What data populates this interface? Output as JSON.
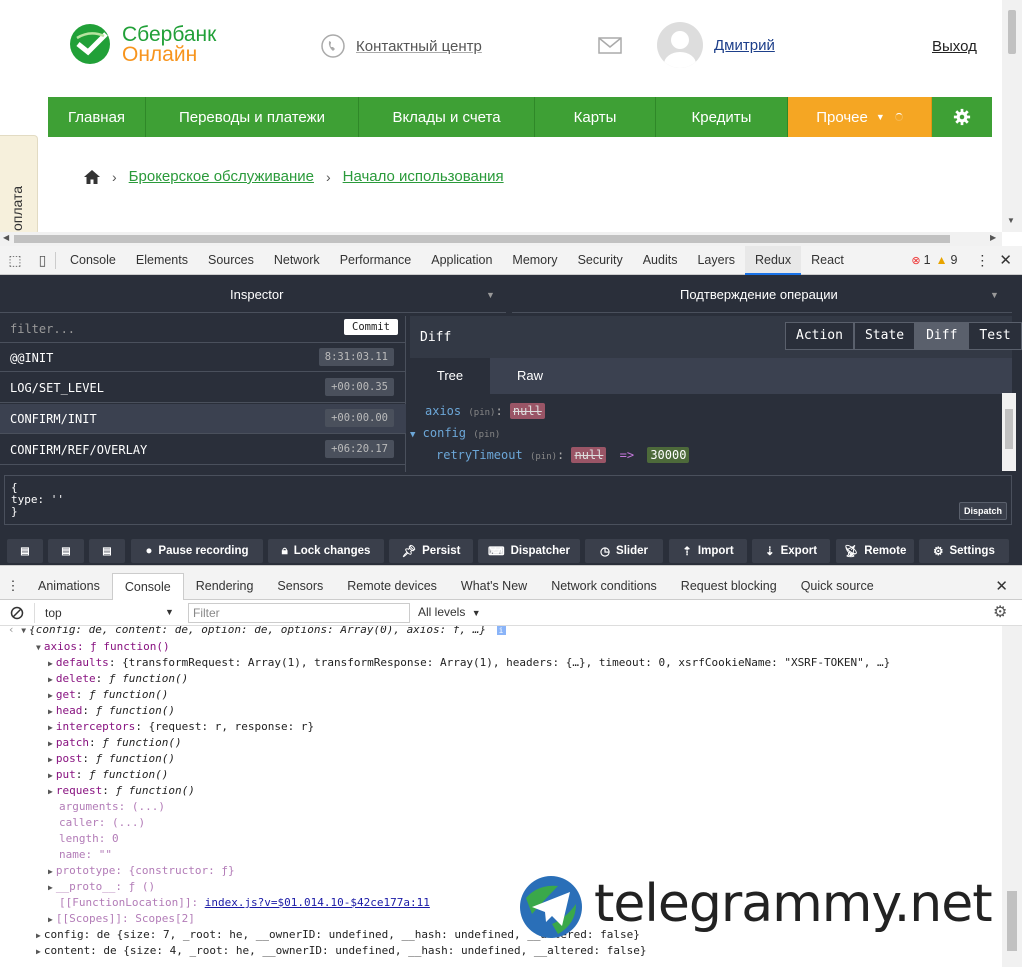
{
  "site": {
    "logo": {
      "line1": "Сбербанк",
      "line2": "Онлайн"
    },
    "contact": "Контактный центр",
    "user_name": "Дмитрий",
    "logout": "Выход",
    "nav": [
      {
        "label": "Главная"
      },
      {
        "label": "Переводы и платежи"
      },
      {
        "label": "Вклады и счета"
      },
      {
        "label": "Карты"
      },
      {
        "label": "Кредиты"
      },
      {
        "label": "Прочее"
      }
    ],
    "breadcrumb": [
      "Брокерское обслуживание",
      "Начало использования"
    ],
    "side_tab": "оплата",
    "colors": {
      "green": "#3ea035",
      "orange": "#f5a623",
      "link": "#2a9a3a"
    }
  },
  "devtools": {
    "tabs": [
      "Console",
      "Elements",
      "Sources",
      "Network",
      "Performance",
      "Application",
      "Memory",
      "Security",
      "Audits",
      "Layers",
      "Redux",
      "React"
    ],
    "active_tab": "Redux",
    "errors": "1",
    "warnings": "9"
  },
  "redux": {
    "left_header": "Inspector",
    "right_header": "Подтверждение операции",
    "filter_placeholder": "filter...",
    "commit": "Commit",
    "actions": [
      {
        "name": "@@INIT",
        "time": "8:31:03.11"
      },
      {
        "name": "LOG/SET_LEVEL",
        "time": "+00:00.35"
      },
      {
        "name": "CONFIRM/INIT",
        "time": "+00:00.00"
      },
      {
        "name": "CONFIRM/REF/OVERLAY",
        "time": "+06:20.17"
      }
    ],
    "panel_title": "Diff",
    "view_buttons": [
      "Action",
      "State",
      "Diff",
      "Test"
    ],
    "subtabs": [
      "Tree",
      "Raw"
    ],
    "tree": {
      "axios": "axios",
      "config": "config",
      "retry": "retryTimeout",
      "pin": "(pin)",
      "null_val": "null",
      "arrow": "=>",
      "new_val": "30000"
    },
    "dispatch_text": [
      "{",
      "type: ''",
      "}"
    ],
    "dispatch_btn": "Dispatch",
    "buttons": [
      "Pause recording",
      "Lock changes",
      "Persist",
      "Dispatcher",
      "Slider",
      "Import",
      "Export",
      "Remote",
      "Settings"
    ]
  },
  "drawer": {
    "tabs": [
      "Animations",
      "Console",
      "Rendering",
      "Sensors",
      "Remote devices",
      "What's New",
      "Network conditions",
      "Request blocking",
      "Quick source"
    ],
    "active": "Console",
    "context": "top",
    "filter_placeholder": "Filter",
    "levels": "All levels"
  },
  "console": {
    "summary": "{config: de, content: de, option: de, options: Array(0), axios: f, …}",
    "axios_line": "axios: ƒ function()",
    "defaults_key": "defaults",
    "defaults_val": "{transformRequest: Array(1), transformResponse: Array(1), headers: {…}, timeout: 0, xsrfCookieName: \"XSRF-TOKEN\", …}",
    "methods": [
      "delete",
      "get",
      "head"
    ],
    "interceptors_val": "{request: r, response: r}",
    "methods2": [
      "patch",
      "post",
      "put",
      "request"
    ],
    "fn": "ƒ function()",
    "arguments": "arguments: (...)",
    "caller": "caller: (...)",
    "length": "length: 0",
    "name": "name: \"\"",
    "prototype": "prototype: {constructor: ƒ}",
    "proto": "__proto__: ƒ ()",
    "fnloc_key": "[[FunctionLocation]]:",
    "fnloc_val": "index.js?v=$01.014.10-$42ce177a:11",
    "scopes": "[[Scopes]]: Scopes[2]",
    "config_line": "config: de {size: 7, _root: he, __ownerID: undefined, __hash: undefined, __altered: false}",
    "content_line": "content: de {size: 4, _root: he, __ownerID: undefined, __hash: undefined, __altered: false}"
  },
  "watermark": "telegrammy.net"
}
